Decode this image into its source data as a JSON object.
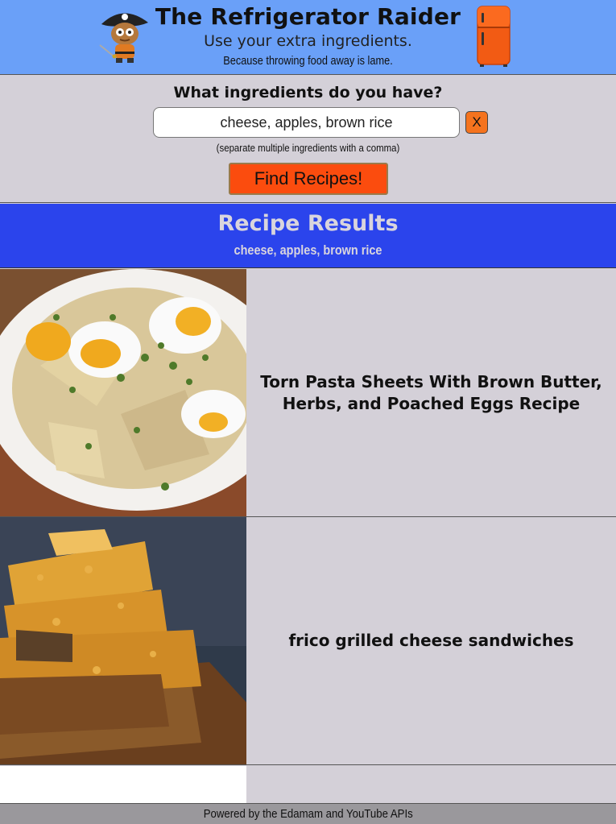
{
  "header": {
    "title": "The Refrigerator Raider",
    "subtitle": "Use your extra ingredients.",
    "tagline": "Because throwing food away is lame."
  },
  "search": {
    "question": "What ingredients do you have?",
    "value": "cheese, apples, brown rice",
    "clear_label": "X",
    "hint": "(separate multiple ingredients with a comma)",
    "button_label": "Find Recipes!"
  },
  "results": {
    "title": "Recipe Results",
    "query": "cheese, apples, brown rice",
    "recipes": [
      {
        "title": "Torn Pasta Sheets With Brown Butter, Herbs, and Poached Eggs Recipe",
        "image": "pasta-eggs-photo"
      },
      {
        "title": "frico grilled cheese sandwiches",
        "image": "grilled-cheese-photo"
      }
    ]
  },
  "footer": {
    "text": "Powered by the Edamam and YouTube APIs"
  },
  "colors": {
    "header_bg": "#6aa0f8",
    "results_bg": "#2b44ec",
    "panel_bg": "#d4d0d8",
    "button": "#fb4c0e",
    "footer_bg": "#9a989c"
  }
}
